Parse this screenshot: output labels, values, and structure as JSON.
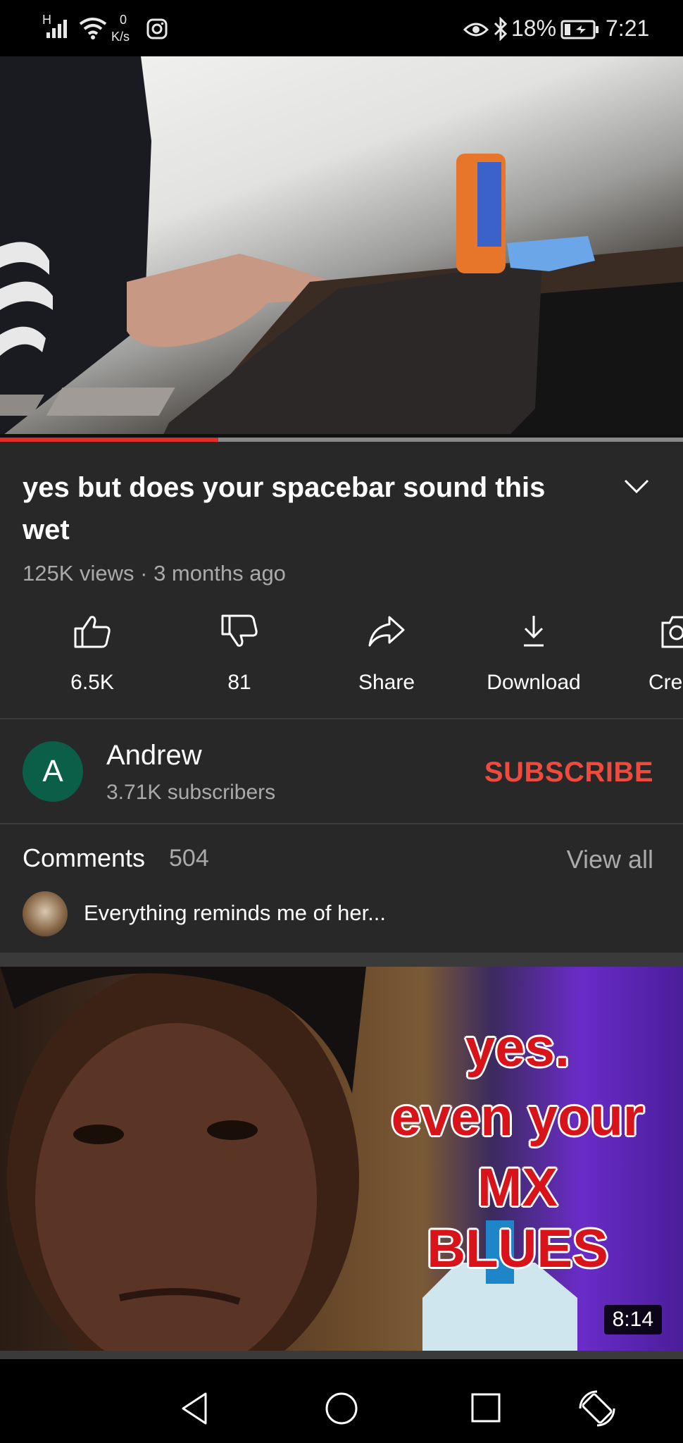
{
  "status_bar": {
    "network": "H",
    "speed_value": "0",
    "speed_unit": "K/s",
    "battery": "18%",
    "time": "7:21"
  },
  "video": {
    "progress": 0.32,
    "title": "yes but does your spacebar sound this wet",
    "meta": "125K views · 3 months ago"
  },
  "actions": [
    {
      "label": "6.5K",
      "icon": "like-icon"
    },
    {
      "label": "81",
      "icon": "dislike-icon"
    },
    {
      "label": "Share",
      "icon": "share-icon"
    },
    {
      "label": "Download",
      "icon": "download-icon"
    },
    {
      "label": "Cre",
      "icon": "create-icon"
    }
  ],
  "channel": {
    "avatar_letter": "A",
    "name": "Andrew",
    "subscribers": "3.71K subscribers",
    "subscribe_label": "SUBSCRIBE"
  },
  "comments": {
    "label": "Comments",
    "count": "504",
    "view_all": "View all",
    "top_comment": "Everything reminds me of her..."
  },
  "next_video": {
    "thumb_line1": "yes.",
    "thumb_line2": "even your",
    "thumb_line3": "MX BLUES",
    "duration": "8:14"
  },
  "colors": {
    "accent": "#ee4a3d",
    "progress": "#e52d27",
    "background": "#282828"
  }
}
